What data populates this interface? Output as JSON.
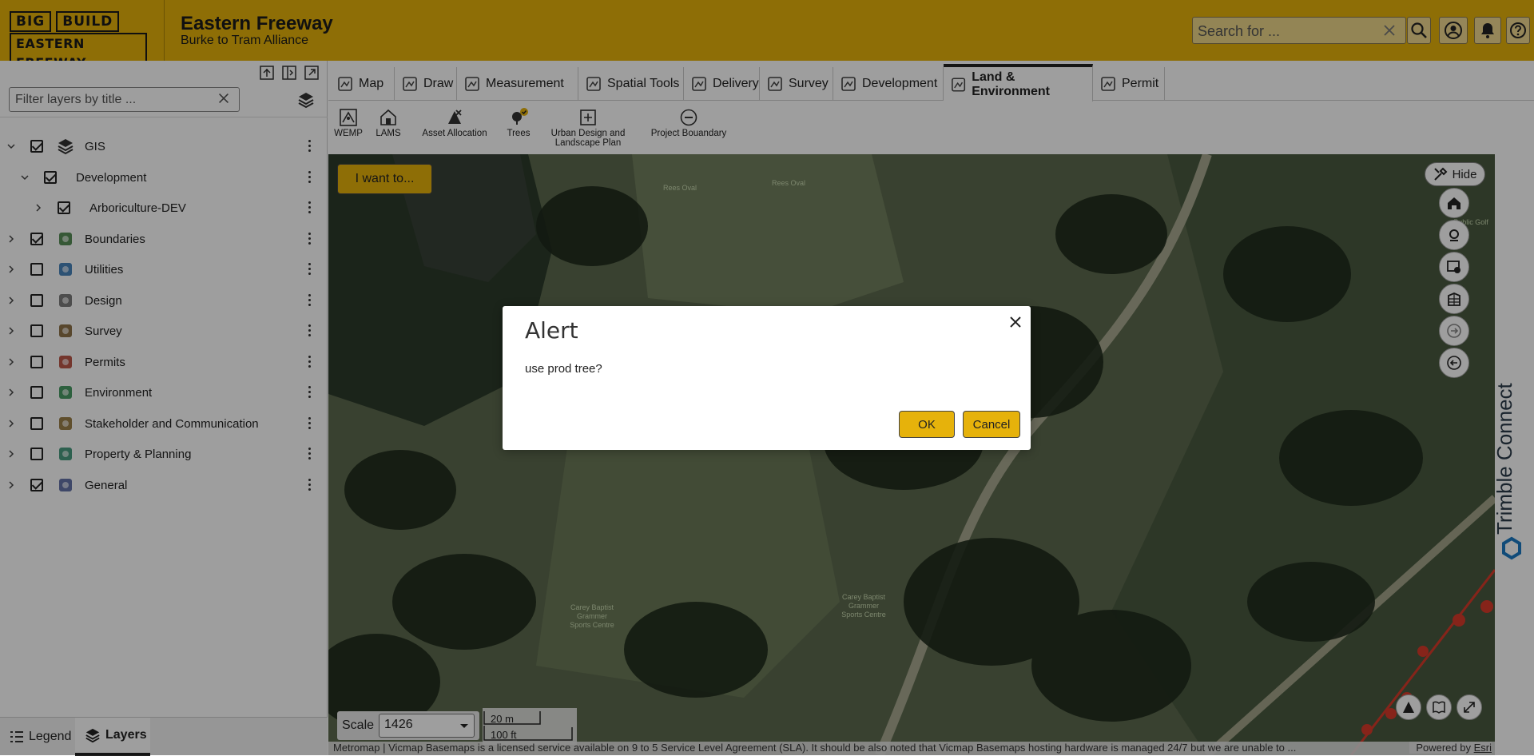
{
  "header": {
    "logo_line1a": "BIG",
    "logo_line1b": "BUILD",
    "logo_line2": "EASTERN FREEWAY",
    "title": "Eastern Freeway",
    "subtitle": "Burke to Tram  Alliance",
    "search_placeholder": "Search for ...",
    "brand_color": "#e6b20b"
  },
  "sidebar": {
    "filter_placeholder": "Filter layers by title ...",
    "layers": [
      {
        "label": "GIS",
        "checked": true,
        "expanded": true,
        "icon": "stack-icon"
      },
      {
        "label": "Development",
        "checked": true,
        "expanded": true,
        "icon": null
      },
      {
        "label": "Arboriculture-DEV",
        "checked": true,
        "expanded": false,
        "icon": null
      },
      {
        "label": "Boundaries",
        "checked": true,
        "expanded": false,
        "icon": "boundaries-icon"
      },
      {
        "label": "Utilities",
        "checked": false,
        "expanded": false,
        "icon": "utilities-icon"
      },
      {
        "label": "Design",
        "checked": false,
        "expanded": false,
        "icon": "design-icon"
      },
      {
        "label": "Survey",
        "checked": false,
        "expanded": false,
        "icon": "survey-icon"
      },
      {
        "label": "Permits",
        "checked": false,
        "expanded": false,
        "icon": "permits-icon"
      },
      {
        "label": "Environment",
        "checked": false,
        "expanded": false,
        "icon": "environment-icon"
      },
      {
        "label": "Stakeholder and Communication",
        "checked": false,
        "expanded": false,
        "icon": "stakeholder-icon"
      },
      {
        "label": "Property & Planning",
        "checked": false,
        "expanded": false,
        "icon": "property-icon"
      },
      {
        "label": "General",
        "checked": true,
        "expanded": false,
        "icon": "general-icon"
      }
    ],
    "bottom_tabs": [
      "Legend",
      "Layers"
    ]
  },
  "tabs": [
    "Map",
    "Draw",
    "Measurement",
    "Spatial Tools",
    "Delivery",
    "Survey",
    "Development",
    "Land & Environment",
    "Permit"
  ],
  "active_tab": "Land & Environment",
  "toolbar": {
    "tools": [
      "WEMP",
      "LAMS",
      "Asset Allocation",
      "Trees",
      "Urban Design and",
      "Landscape Plan",
      "Project Bouandary"
    ]
  },
  "map": {
    "i_want_to": "I want to...",
    "hide": "Hide",
    "scale_label": "Scale",
    "scale_value": "1426",
    "scalebar_m": "20 m",
    "scalebar_ft": "100 ft",
    "labels": [
      "Rees Oval",
      "Rees Oval",
      "Carey Baptist",
      "Grammer",
      "Sports Centre",
      "Carey Baptist",
      "Grammer",
      "Sports Centre",
      "Public Golf"
    ],
    "attribution": "Metromap | Vicmap Basemaps is a licensed service available on 9 to 5 Service Level Agreement (SLA). It should be also noted that Vicmap Basemaps hosting hardware is managed 24/7 but we are unable to ...",
    "powered_by": "Powered by",
    "esri": "Esri",
    "trimble": "Trimble Connect"
  },
  "dialog": {
    "title": "Alert",
    "message": "use prod tree?",
    "ok": "OK",
    "cancel": "Cancel"
  }
}
